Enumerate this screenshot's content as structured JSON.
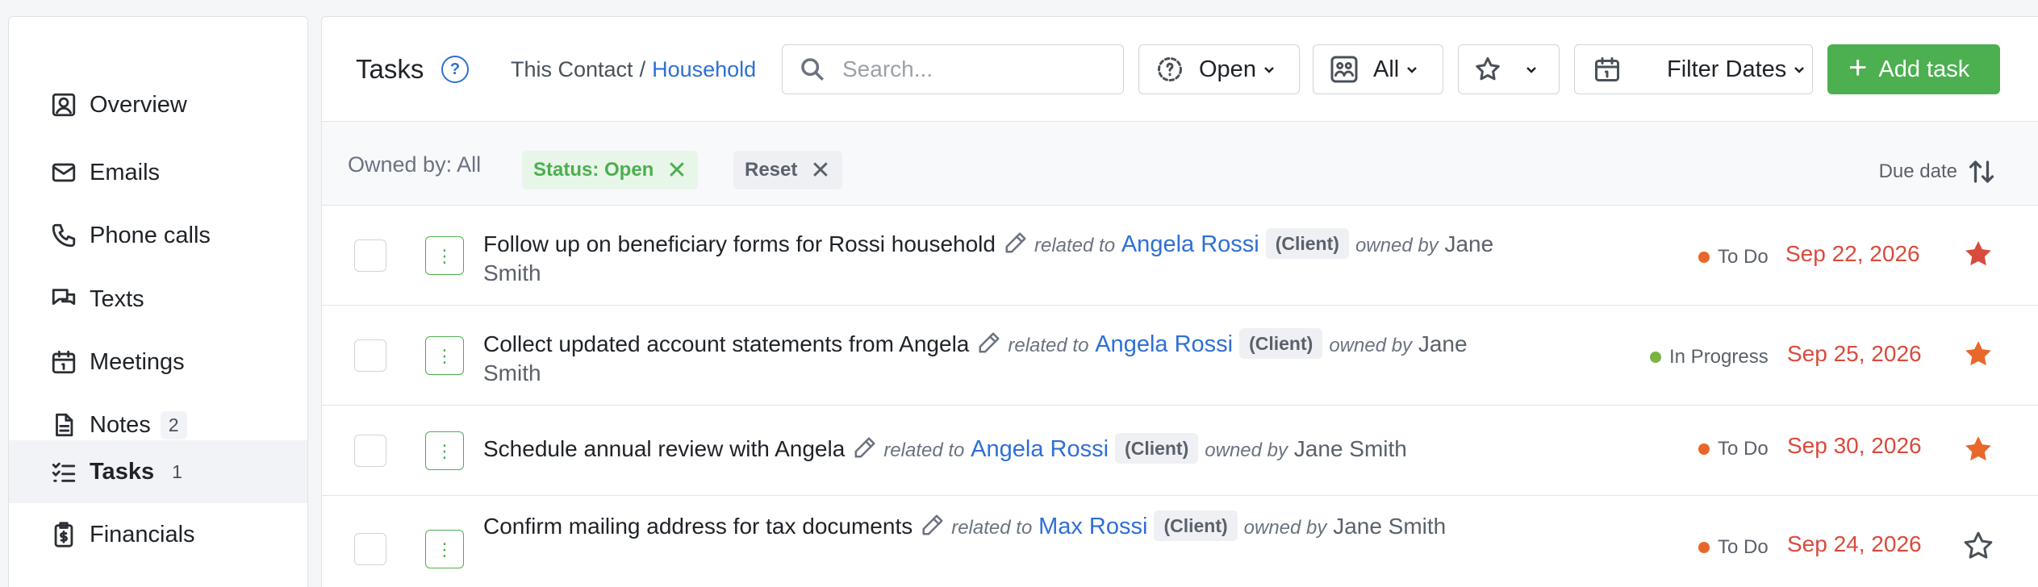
{
  "sidebar": {
    "items": [
      {
        "label": "Overview",
        "icon": "user-icon"
      },
      {
        "label": "Emails",
        "icon": "mail-icon"
      },
      {
        "label": "Phone calls",
        "icon": "phone-icon"
      },
      {
        "label": "Texts",
        "icon": "chat-icon"
      },
      {
        "label": "Meetings",
        "icon": "calendar-icon"
      },
      {
        "label": "Notes",
        "icon": "document-icon",
        "count": "2"
      },
      {
        "label": "Tasks",
        "icon": "checklist-icon",
        "count": "1",
        "active": true
      },
      {
        "label": "Financials",
        "icon": "clipboard-dollar-icon"
      }
    ]
  },
  "header": {
    "title": "Tasks",
    "help": "?",
    "breadcrumb_1": "This Contact",
    "breadcrumb_sep": "/",
    "breadcrumb_2": "Household",
    "search_placeholder": "Search...",
    "status_filter": "Open",
    "owner_filter": "All",
    "date_filter": "Filter Dates",
    "add_label": "Add task"
  },
  "filters": {
    "owned_by": "Owned by: All",
    "status_chip": "Status: Open",
    "reset_chip": "Reset",
    "sort_label": "Due date"
  },
  "colors": {
    "accent": "#4caf50",
    "link": "#2f6fd6",
    "overdue_date": "#d94b3c",
    "todo_dot": "#e8672a",
    "in_progress_dot": "#7cb342",
    "star_filled": "#e8672a",
    "star_filled_red": "#d94b3c"
  },
  "tasks": [
    {
      "title": "Follow up on beneficiary forms for Rossi household",
      "related_word": "related to",
      "person": "Angela Rossi",
      "tag": "(Client)",
      "owned_word": "owned by",
      "owner": "Jane Smith",
      "status": "To Do",
      "date": "Sep 22, 2026",
      "starred": true
    },
    {
      "title": "Collect updated account statements from Angela",
      "related_word": "related to",
      "person": "Angela Rossi",
      "tag": "(Client)",
      "owned_word": "owned by",
      "owner": "Jane Smith",
      "status": "In Progress",
      "date": "Sep 25, 2026",
      "starred": true
    },
    {
      "title": "Schedule annual review with Angela",
      "related_word": "related to",
      "person": "Angela Rossi",
      "tag": "(Client)",
      "owned_word": "owned by",
      "owner": "Jane Smith",
      "status": "To Do",
      "date": "Sep 30, 2026",
      "starred": true
    },
    {
      "title": "Confirm mailing address for tax documents",
      "related_word": "related to",
      "person": "Max Rossi",
      "tag": "(Client)",
      "owned_word": "owned by",
      "owner": "Jane Smith",
      "status": "To Do",
      "date": "Sep 24, 2026",
      "starred": false
    }
  ]
}
